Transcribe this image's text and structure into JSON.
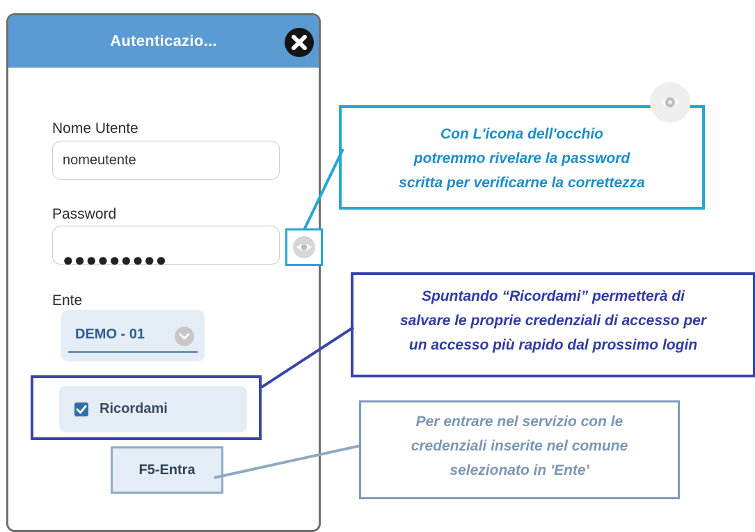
{
  "dialog": {
    "title": "Autenticazio...",
    "close_icon": "close-icon",
    "username": {
      "label": "Nome Utente",
      "value": "nomeutente"
    },
    "password": {
      "label": "Password",
      "masked_value": "●●●●●●●●●",
      "reveal_icon": "eye-icon"
    },
    "ente": {
      "label": "Ente",
      "value": "DEMO - 01",
      "chevron_icon": "chevron-down-icon"
    },
    "remember": {
      "label": "Ricordami",
      "checked": true
    },
    "enter_button": "F5-Entra"
  },
  "callouts": {
    "eye": [
      "Con L'icona dell'occhio",
      "potremmo rivelare la password",
      "scritta per verificarne la correttezza"
    ],
    "remember": [
      "Spuntando “Ricordami” permetterà di",
      "salvare le proprie credenziali di accesso per",
      "un accesso più rapido dal prossimo login"
    ],
    "enter": [
      "Per entrare nel servizio con le",
      "credenziali inserite nel comune",
      "selezionato in 'Ente'"
    ]
  },
  "colors": {
    "header": "#5b9bd3",
    "callout_eye": "#23a6d8",
    "callout_remember": "#3746a8",
    "callout_enter": "#7f9bb8"
  }
}
